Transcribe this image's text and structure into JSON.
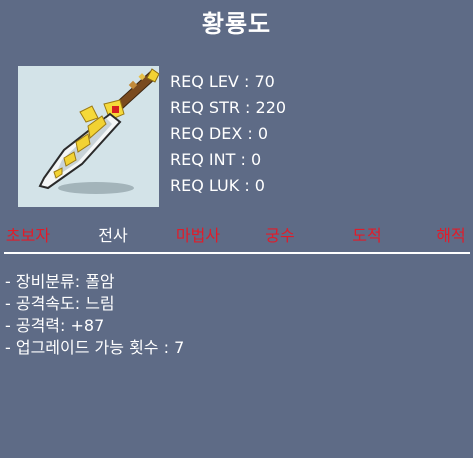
{
  "item": {
    "name": "황룡도",
    "icon": "golden-dragon-blade-polearm-icon"
  },
  "requirements": [
    {
      "label": "REQ LEV",
      "value": "70"
    },
    {
      "label": "REQ STR",
      "value": "220"
    },
    {
      "label": "REQ DEX",
      "value": "0"
    },
    {
      "label": "REQ INT",
      "value": "0"
    },
    {
      "label": "REQ LUK",
      "value": "0"
    }
  ],
  "jobs": [
    {
      "label": "초보자",
      "allowed": false
    },
    {
      "label": "전사",
      "allowed": true
    },
    {
      "label": "마법사",
      "allowed": false
    },
    {
      "label": "궁수",
      "allowed": false
    },
    {
      "label": "도적",
      "allowed": false
    },
    {
      "label": "해적",
      "allowed": false
    }
  ],
  "stats": [
    "- 장비분류: 폴암",
    "- 공격속도: 느림",
    "- 공격력: +87",
    "- 업그레이드 가능 횟수 : 7"
  ],
  "colors": {
    "background": "#5e6b86",
    "text": "#ffffff",
    "job_disallowed": "#e01c2a",
    "icon_frame": "#d3e3e8"
  }
}
